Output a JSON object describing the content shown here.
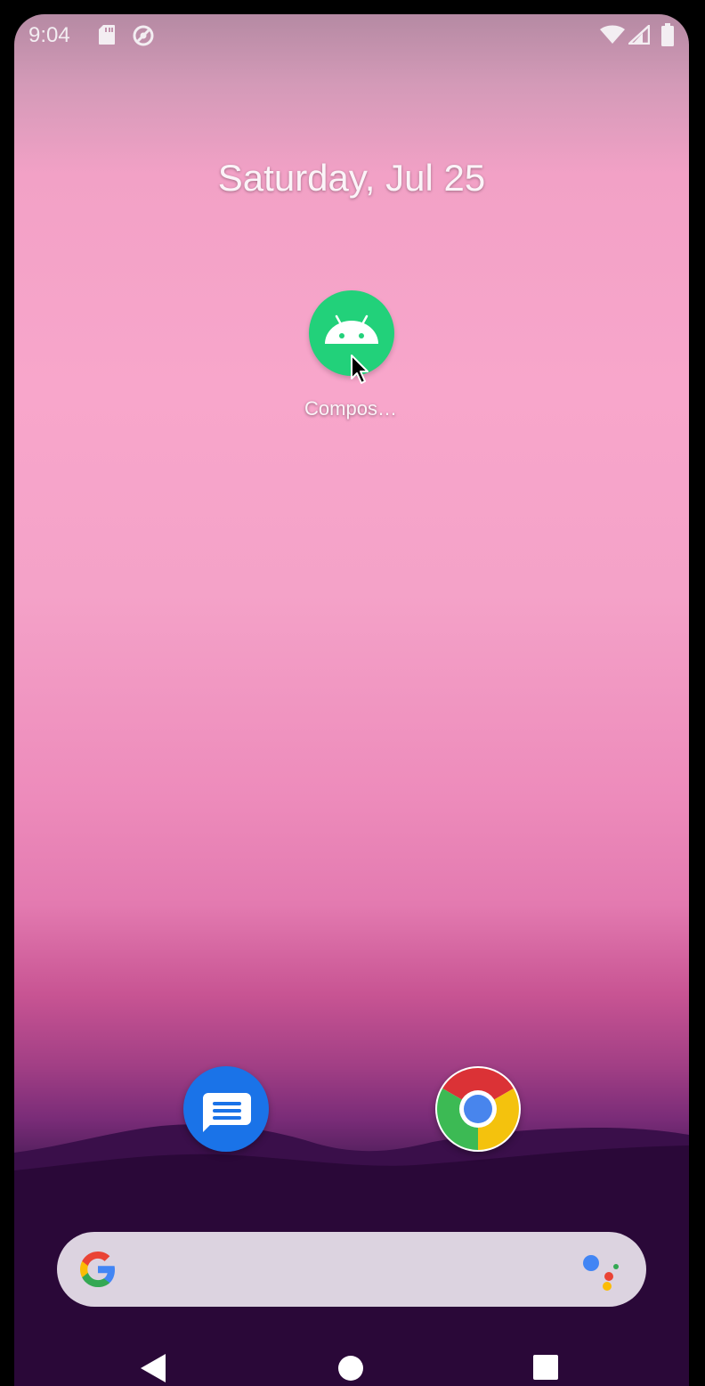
{
  "status_bar": {
    "time": "9:04",
    "left_icons": [
      "sd-card-icon",
      "sync-icon"
    ],
    "right_icons": [
      "wifi-icon",
      "cell-signal-icon",
      "battery-icon"
    ]
  },
  "home": {
    "date": "Saturday, Jul 25",
    "apps": [
      {
        "label": "Compos…",
        "icon": "android-icon",
        "color": "#22d17a"
      }
    ]
  },
  "dock": {
    "apps": [
      {
        "icon": "messages-icon",
        "color": "#1a73e8"
      },
      {
        "icon": "chrome-icon"
      }
    ]
  },
  "search_bar": {
    "icons": [
      "google-g-icon",
      "assistant-icon"
    ]
  },
  "nav_bar": {
    "buttons": [
      "back",
      "home",
      "recents"
    ]
  }
}
